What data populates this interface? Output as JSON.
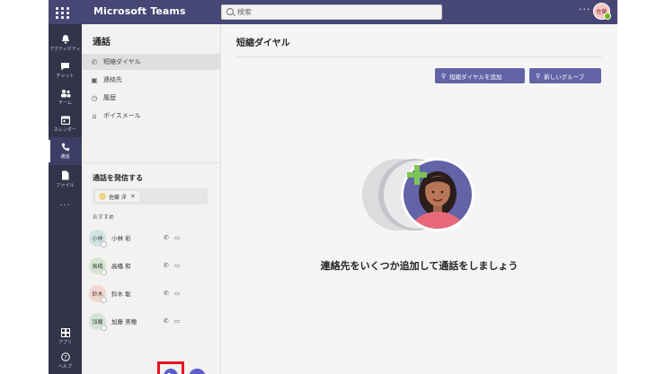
{
  "app": {
    "title": "Microsoft Teams",
    "search_placeholder": "検索",
    "more": "···",
    "user_initials": "佐藤"
  },
  "rail": {
    "items": [
      {
        "label": "アクティビティ",
        "icon": "bell-icon"
      },
      {
        "label": "チャット",
        "icon": "chat-icon"
      },
      {
        "label": "チーム",
        "icon": "teams-icon"
      },
      {
        "label": "カレンダー",
        "icon": "calendar-icon"
      },
      {
        "label": "通話",
        "icon": "phone-icon",
        "active": true
      },
      {
        "label": "ファイル",
        "icon": "file-icon"
      }
    ],
    "more": "···",
    "bottom": [
      {
        "label": "アプリ",
        "icon": "apps-icon"
      },
      {
        "label": "ヘルプ",
        "icon": "help-icon"
      }
    ]
  },
  "calls": {
    "title": "通話",
    "nav": [
      {
        "label": "短縮ダイヤル",
        "icon": "speed-dial-icon",
        "selected": true
      },
      {
        "label": "連絡先",
        "icon": "contacts-icon"
      },
      {
        "label": "履歴",
        "icon": "history-icon"
      },
      {
        "label": "ボイスメール",
        "icon": "voicemail-icon"
      }
    ],
    "make_call_title": "通話を発信する",
    "recipient": "佐藤 洋",
    "suggested_label": "おすすめ",
    "contacts": [
      {
        "initials": "小林",
        "name": "小林 彩",
        "color": "#cfe3e3"
      },
      {
        "initials": "高橋",
        "name": "高橋 和",
        "color": "#d6e6cf"
      },
      {
        "initials": "鈴木",
        "name": "鈴木 聡",
        "color": "#f2d6cf"
      },
      {
        "initials": "加藤",
        "name": "加藤 美穂",
        "color": "#d2e4d8"
      }
    ]
  },
  "main": {
    "title": "短縮ダイヤル",
    "add_button": "短縮ダイヤルを追加",
    "new_group_button": "新しいグループ",
    "empty_message": "連絡先をいくつか追加して通話をしましょう"
  },
  "colors": {
    "brand": "#464775",
    "accent": "#6264a7",
    "highlight": "#e8121f"
  }
}
